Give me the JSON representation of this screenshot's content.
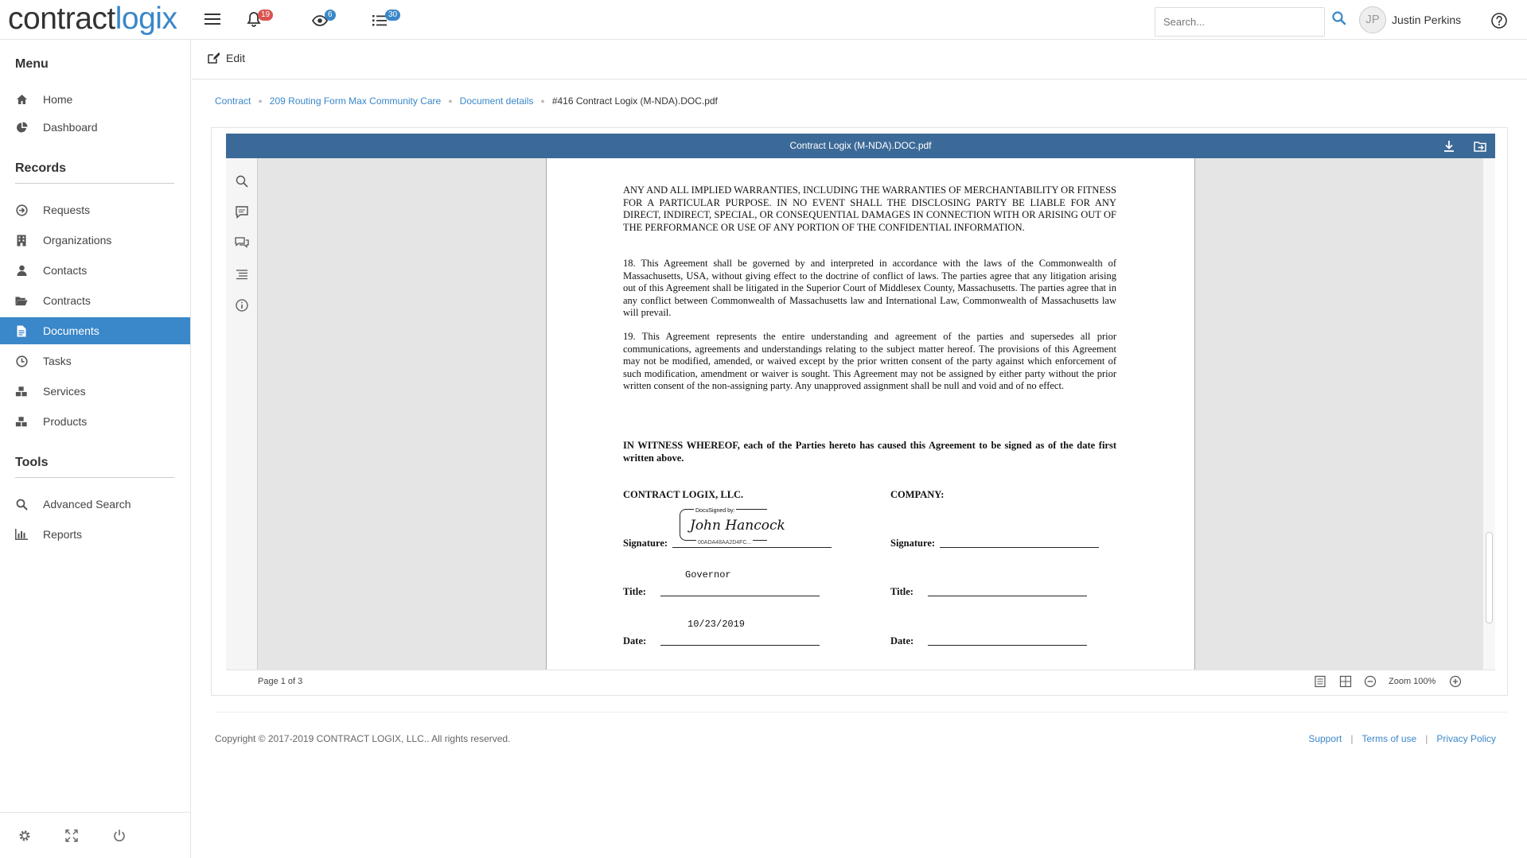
{
  "brand": {
    "part1": "contract",
    "part2": "logix",
    "primary_color": "#3a87c9"
  },
  "topbar": {
    "notifications_count": "19",
    "watch_count": "6",
    "tasks_count": "30",
    "search_placeholder": "Search...",
    "avatar_initials": "JP",
    "user_name": "Justin Perkins"
  },
  "sidebar": {
    "menu_heading": "Menu",
    "menu_items": [
      {
        "label": "Home",
        "icon": "home-icon"
      },
      {
        "label": "Dashboard",
        "icon": "pie-chart-icon"
      }
    ],
    "records_heading": "Records",
    "records_items": [
      {
        "label": "Requests",
        "icon": "arrow-circle-icon"
      },
      {
        "label": "Organizations",
        "icon": "building-icon"
      },
      {
        "label": "Contacts",
        "icon": "user-icon"
      },
      {
        "label": "Contracts",
        "icon": "folder-open-icon"
      },
      {
        "label": "Documents",
        "icon": "file-text-icon",
        "active": true
      },
      {
        "label": "Tasks",
        "icon": "clock-icon"
      },
      {
        "label": "Services",
        "icon": "cubes-icon"
      },
      {
        "label": "Products",
        "icon": "cubes-icon"
      }
    ],
    "tools_heading": "Tools",
    "tools_items": [
      {
        "label": "Advanced Search",
        "icon": "search-icon"
      },
      {
        "label": "Reports",
        "icon": "bar-chart-icon"
      }
    ]
  },
  "editbar": {
    "edit_label": "Edit"
  },
  "breadcrumb": {
    "items": [
      "Contract",
      "209 Routing Form Max Community Care",
      "Document details"
    ],
    "current": "#416 Contract Logix (M-NDA).DOC.pdf"
  },
  "viewer": {
    "title": "Contract Logix (M-NDA).DOC.pdf",
    "page_indicator": "Page 1 of 3",
    "zoom_label": "Zoom 100%"
  },
  "document": {
    "para_warranty": "ANY AND ALL IMPLIED WARRANTIES, INCLUDING THE WARRANTIES OF MERCHANTABILITY OR FITNESS FOR A PARTICULAR PURPOSE.  IN NO EVENT SHALL THE DISCLOSING PARTY BE LIABLE FOR ANY DIRECT, INDIRECT, SPECIAL, OR CONSEQUENTIAL DAMAGES IN CONNECTION WITH OR ARISING OUT OF THE PERFORMANCE OR USE OF ANY PORTION OF THE CONFIDENTIAL INFORMATION.",
    "para_18": "18. This Agreement shall be governed by and interpreted in accordance with the laws of the Commonwealth of Massachusetts, USA, without giving effect to the doctrine of conflict of laws. The parties agree that any litigation arising out of this Agreement shall be litigated in the Superior Court of Middlesex County, Massachusetts.  The parties agree that in any conflict between Commonwealth of Massachusetts law and International Law, Commonwealth of Massachusetts law will prevail.",
    "para_19": "19. This Agreement represents the entire understanding and agreement of the parties and supersedes all prior communications, agreements and understandings relating to the subject matter hereof.  The provisions of this Agreement may not be modified, amended, or waived except by the prior written consent of the party against which enforcement of such modification, amendment or waiver is sought.  This Agreement may not be assigned by either party without the prior written consent of the non-assigning party.  Any unapproved assignment shall be null and void and of no effect.",
    "witness": "IN WITNESS WHEREOF, each of the Parties hereto has caused this Agreement to be signed as of the date first written above.",
    "party_left": "CONTRACT LOGIX, LLC.",
    "party_right": "COMPANY:",
    "signature_label": "Signature:",
    "title_label": "Title:",
    "date_label": "Date:",
    "docusign_header": "DocuSigned by:",
    "signature_name": "John Hancock",
    "docusign_id": "00ADA48AA2D4FC...",
    "title_value": "Governor",
    "date_value": "10/23/2019"
  },
  "footer": {
    "copyright": "Copyright © 2017-2019 CONTRACT LOGIX, LLC.. All rights reserved.",
    "links": [
      "Support",
      "Terms of use",
      "Privacy Policy"
    ]
  }
}
